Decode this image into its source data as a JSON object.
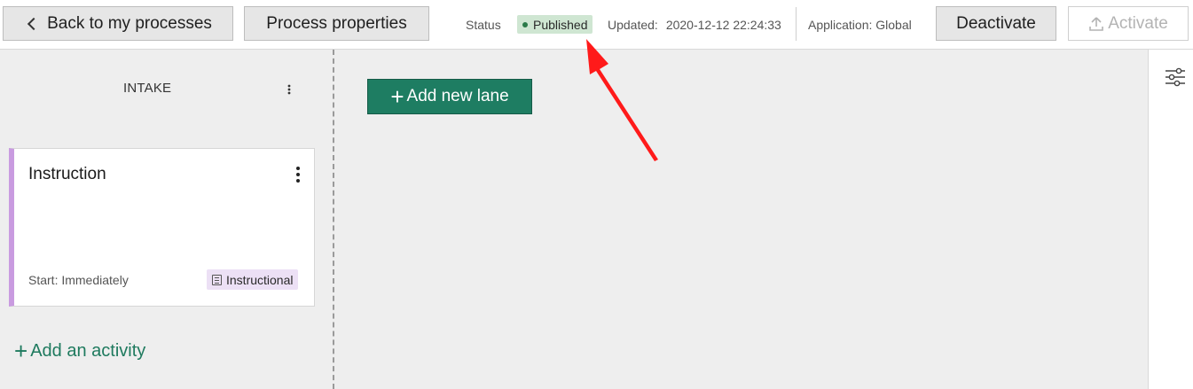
{
  "topbar": {
    "back_label": "Back to my processes",
    "properties_label": "Process properties",
    "status_label": "Status",
    "status_value": "Published",
    "updated_label": "Updated:",
    "updated_value": "2020-12-12 22:24:33",
    "application_text": "Application: Global",
    "deactivate_label": "Deactivate",
    "activate_label": "Activate"
  },
  "lane": {
    "title": "INTAKE",
    "card": {
      "title": "Instruction",
      "start_text": "Start: Immediately",
      "tag_label": "Instructional"
    },
    "add_activity_label": "Add an activity"
  },
  "main": {
    "add_lane_label": "Add new lane"
  },
  "colors": {
    "primary_green": "#1e7d62",
    "status_badge_bg": "#cfe6d2",
    "card_accent": "#c99be0",
    "tag_bg": "#ece0f5",
    "annotation_arrow": "#ff1a1a"
  },
  "icons": [
    "chevron-left-icon",
    "status-dot-icon",
    "upload-icon",
    "kebab-icon",
    "document-icon",
    "plus-icon",
    "sliders-icon"
  ]
}
